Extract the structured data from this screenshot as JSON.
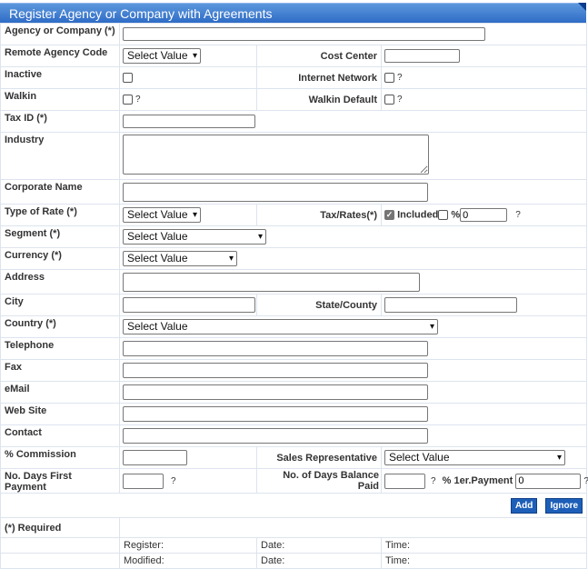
{
  "title": "Register Agency or Company with Agreements",
  "labels": {
    "agency": "Agency or Company (*)",
    "remote_code": "Remote Agency Code",
    "cost_center": "Cost Center",
    "inactive": "Inactive",
    "internet_network": "Internet Network",
    "walkin": "Walkin",
    "walkin_default": "Walkin Default",
    "tax_id": "Tax ID (*)",
    "industry": "Industry",
    "corporate_name": "Corporate Name",
    "type_of_rate": "Type of Rate (*)",
    "tax_rates": "Tax/Rates(*)",
    "included": "Included",
    "percent": "%",
    "segment": "Segment (*)",
    "currency": "Currency (*)",
    "address": "Address",
    "city": "City",
    "state": "State/County",
    "country": "Country (*)",
    "telephone": "Telephone",
    "fax": "Fax",
    "email": "eMail",
    "website": "Web Site",
    "contact": "Contact",
    "commission": "% Commission",
    "sales_rep": "Sales Representative",
    "days_first_payment": "No. Days First Payment",
    "days_balance_paid": "No. of Days Balance Paid",
    "first_payment_pct": "% 1er.Payment"
  },
  "help_mark": "?",
  "select_placeholder": "Select Value",
  "values": {
    "tax_rate": "0",
    "first_payment_pct": "0"
  },
  "checkboxes": {
    "inactive": false,
    "internet_network": false,
    "walkin": false,
    "walkin_default": false,
    "included": true,
    "percent": false
  },
  "buttons": {
    "add": "Add",
    "ignore": "Ignore"
  },
  "footer": {
    "required_note": "(*) Required",
    "register": "Register:",
    "modified": "Modified:",
    "date": "Date:",
    "time": "Time:"
  }
}
